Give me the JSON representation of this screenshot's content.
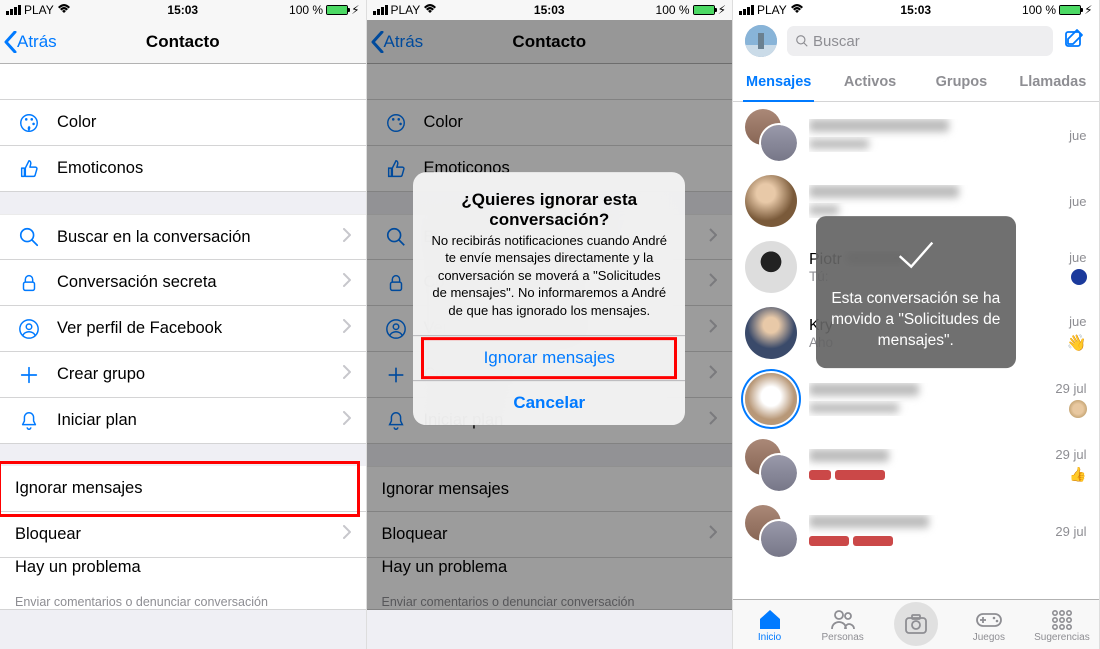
{
  "status": {
    "carrier": "PLAY",
    "time": "15:03",
    "battery_pct": "100 %"
  },
  "nav": {
    "back": "Atrás",
    "title": "Contacto"
  },
  "panel1": {
    "truncated_top": "",
    "rows": [
      {
        "icon": "palette",
        "label": "Color"
      },
      {
        "icon": "like",
        "label": "Emoticonos"
      }
    ],
    "rows2": [
      {
        "icon": "search",
        "label": "Buscar en la conversación",
        "chev": true
      },
      {
        "icon": "lock",
        "label": "Conversación secreta",
        "chev": true
      },
      {
        "icon": "profile",
        "label": "Ver perfil de Facebook",
        "chev": true
      },
      {
        "icon": "plus",
        "label": "Crear grupo",
        "chev": true
      },
      {
        "icon": "bell",
        "label": "Iniciar plan",
        "chev": true
      }
    ],
    "rows3": [
      {
        "label": "Ignorar mensajes",
        "hl": true
      },
      {
        "label": "Bloquear",
        "chev": true
      },
      {
        "label": "Hay un problema",
        "sub": "Enviar comentarios o denunciar conversación"
      }
    ]
  },
  "alert": {
    "title": "¿Quieres ignorar esta conversación?",
    "message": "No recibirás notificaciones cuando André te envíe mensajes directamente y la conversación se moverá a \"Solicitudes de mensajes\". No informaremos a André de que has ignorado los mensajes.",
    "primary": "Ignorar mensajes",
    "cancel": "Cancelar"
  },
  "panel3": {
    "search_placeholder": "Buscar",
    "tabs": [
      "Mensajes",
      "Activos",
      "Grupos",
      "Llamadas"
    ],
    "chats": [
      {
        "time": "jue"
      },
      {
        "time": "jue"
      },
      {
        "name": "Piotr",
        "preview": "Tú:",
        "time": "jue"
      },
      {
        "name": "Kry",
        "preview": "Aho",
        "time": "jue"
      },
      {
        "time": "29 jul"
      },
      {
        "time": "29 jul"
      },
      {
        "time": "29 jul"
      }
    ],
    "toast": "Esta conversación se ha movido a \"Solicitudes de mensajes\".",
    "tabbar": [
      "Inicio",
      "Personas",
      "",
      "Juegos",
      "Sugerencias"
    ]
  }
}
